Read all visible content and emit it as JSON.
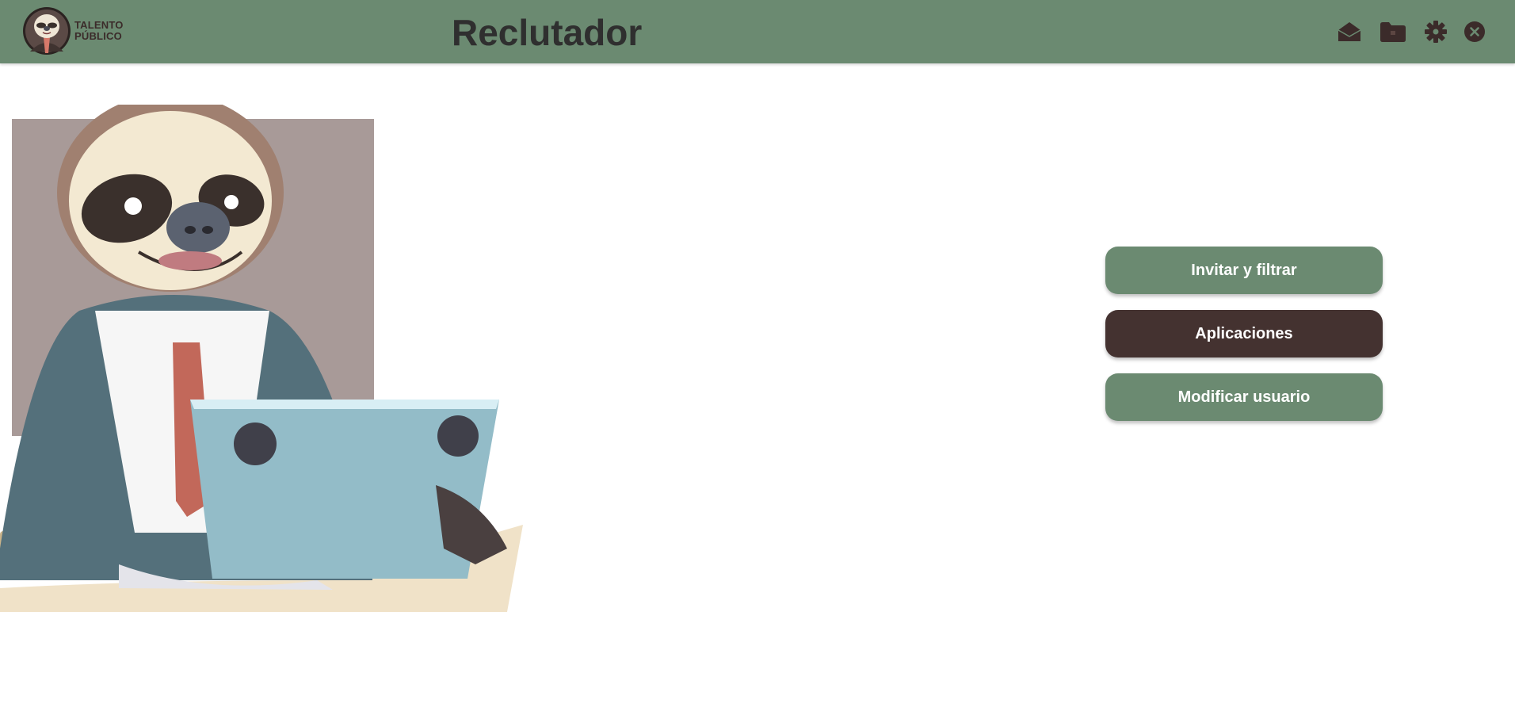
{
  "header": {
    "logo_text_line1": "TALENTO",
    "logo_text_line2": "PÚBLICO",
    "title": "Reclutador",
    "icons": [
      "mail-icon",
      "folder-icon",
      "gear-icon",
      "close-icon"
    ]
  },
  "menu": {
    "invite_label": "Invitar y filtrar",
    "applications_label": "Aplicaciones",
    "modify_user_label": "Modificar usuario"
  },
  "colors": {
    "header_bg": "#6b8a71",
    "button_green": "#6b8a71",
    "button_dark": "#443230",
    "icon_dark": "#3b2b2a",
    "title_text": "#2f2f2f"
  }
}
